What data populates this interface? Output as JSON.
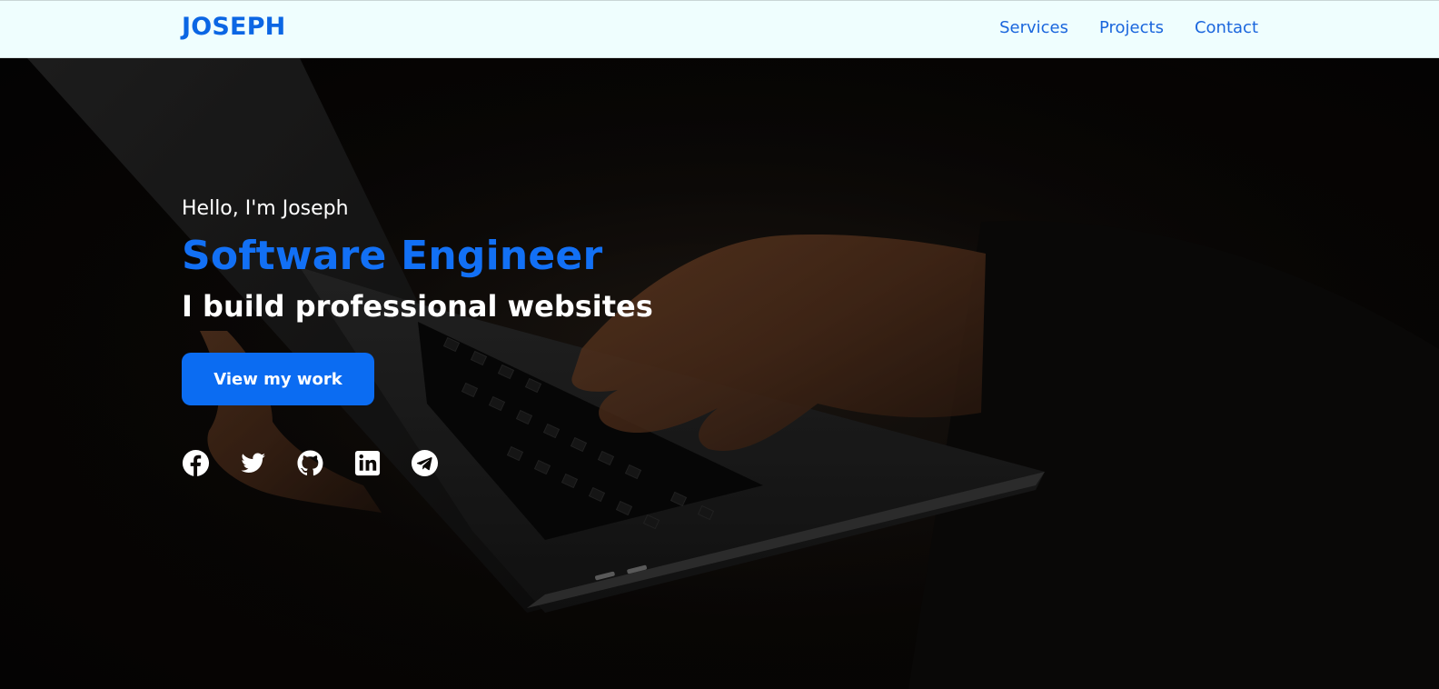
{
  "nav": {
    "brand": "JOSEPH",
    "links": [
      "Services",
      "Projects",
      "Contact"
    ]
  },
  "hero": {
    "greeting": "Hello, I'm Joseph",
    "role": "Software Engineer",
    "tagline": "I build professional websites",
    "cta_label": "View my work",
    "socials": [
      "facebook-icon",
      "twitter-icon",
      "github-icon",
      "linkedin-icon",
      "telegram-icon"
    ]
  },
  "colors": {
    "accent": "#0b6cf2",
    "nav_background": "#effefe",
    "brand": "#0b66e4",
    "text_light": "#ffffff"
  }
}
